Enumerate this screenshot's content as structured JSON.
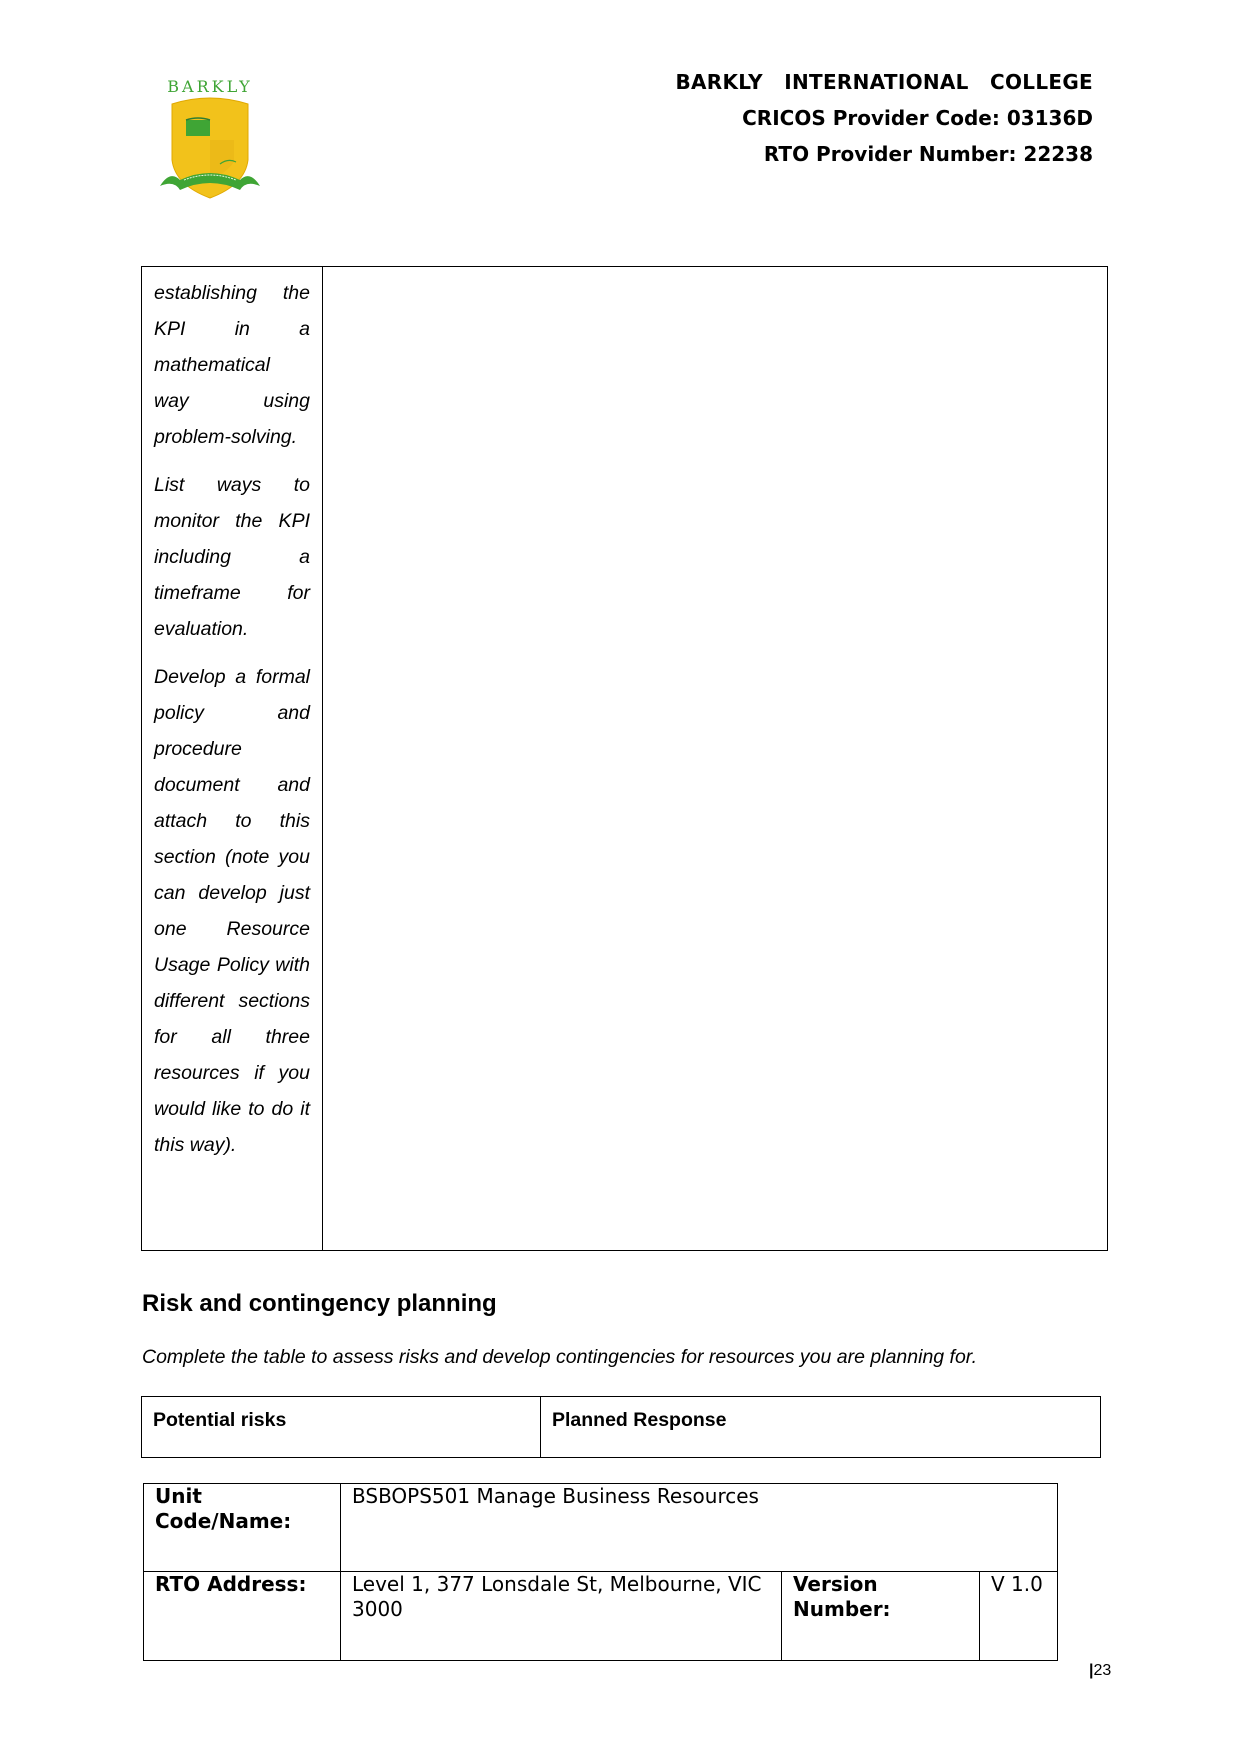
{
  "header": {
    "logo_text": "BARKLY",
    "logo_name": "barkly-college-crest",
    "college_name": "BARKLY INTERNATIONAL COLLEGE",
    "cricos": "CRICOS Provider Code: 03136D",
    "rto": "RTO Provider Number: 22238"
  },
  "main_table": {
    "instructions": [
      "establishing the KPI in a mathematical way using problem-solving.",
      "List ways to monitor the KPI including a timeframe for evaluation.",
      "Develop a formal policy and procedure document and attach to this section (note you can develop just one Resource Usage Policy with different sections for all three resources if you would like to do it this way)."
    ],
    "response": ""
  },
  "risk_section": {
    "heading": "Risk and contingency planning",
    "description": "Complete the table to assess risks and develop contingencies for resources you are planning for.",
    "columns": [
      "Potential risks",
      "Planned Response"
    ]
  },
  "footer": {
    "unit_label": "Unit Code/Name:",
    "unit_value": "BSBOPS501 Manage Business Resources",
    "address_label": "RTO Address:",
    "address_value": "Level 1, 377 Lonsdale St, Melbourne, VIC 3000",
    "version_label": "Version Number:",
    "version_value": "V 1.0",
    "page_separator": "|",
    "page_number": "23"
  },
  "colors": {
    "logo_gold": "#F2C21B",
    "logo_green": "#3FA535",
    "text": "#000000",
    "border": "#000000"
  }
}
